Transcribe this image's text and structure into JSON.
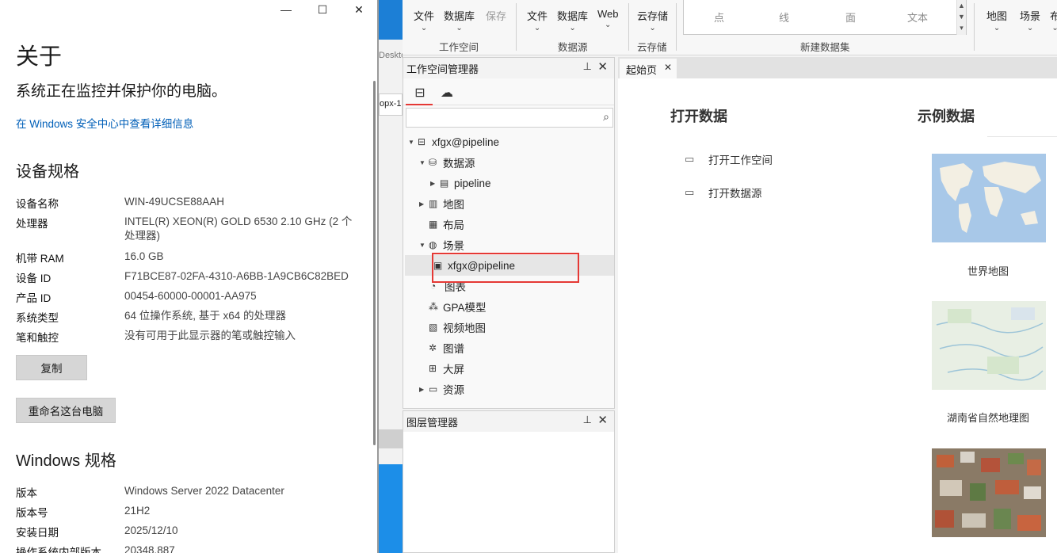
{
  "about": {
    "title": "关于",
    "subtitle": "系统正在监控并保护你的电脑。",
    "link": "在 Windows 安全中心中查看详细信息",
    "device_heading": "设备规格",
    "device_specs": [
      {
        "key": "设备名称",
        "value": "WIN-49UCSE88AAH"
      },
      {
        "key": "处理器",
        "value": "INTEL(R) XEON(R) GOLD 6530   2.10 GHz  (2 个处理器)"
      },
      {
        "key": "机带 RAM",
        "value": "16.0 GB"
      },
      {
        "key": "设备 ID",
        "value": "F71BCE87-02FA-4310-A6BB-1A9CB6C82BED"
      },
      {
        "key": "产品 ID",
        "value": "00454-60000-00001-AA975"
      },
      {
        "key": "系统类型",
        "value": "64 位操作系统, 基于 x64 的处理器"
      },
      {
        "key": "笔和触控",
        "value": "没有可用于此显示器的笔或触控输入"
      }
    ],
    "copy_button": "复制",
    "rename_button": "重命名这台电脑",
    "windows_heading": "Windows 规格",
    "windows_specs": [
      {
        "key": "版本",
        "value": "Windows Server 2022 Datacenter"
      },
      {
        "key": "版本号",
        "value": "21H2"
      },
      {
        "key": "安装日期",
        "value": "2025/12/10"
      },
      {
        "key": "操作系统内部版本",
        "value": "20348.887"
      }
    ],
    "minimize_glyph": "—",
    "maximize_glyph": "☐",
    "close_glyph": "✕"
  },
  "behind": {
    "text1": "Deskto",
    "text2": "opx-1"
  },
  "ribbon": {
    "buttons": {
      "file1": "文件",
      "db1": "数据库",
      "save": "保存",
      "file2": "文件",
      "db2": "数据库",
      "web": "Web",
      "cloud": "云存储",
      "map": "地图",
      "scene": "场景",
      "more": "布"
    },
    "groups": {
      "workspace": "工作空间",
      "datasource": "数据源",
      "cloud": "云存储",
      "newdataset": "新建数据集"
    },
    "gallery": [
      "点",
      "线",
      "面",
      "文本"
    ]
  },
  "workspace_manager": {
    "title": "工作空间管理器",
    "tree": {
      "root": "xfgx@pipeline",
      "datasources": "数据源",
      "pipeline": "pipeline",
      "maps": "地图",
      "layouts": "布局",
      "scenes": "场景",
      "scene_item": "xfgx@pipeline",
      "charts": "图表",
      "gpa": "GPA模型",
      "video_maps": "视频地图",
      "graphs": "图谱",
      "dashboards": "大屏",
      "resources": "资源"
    }
  },
  "layer_manager": {
    "title": "图层管理器"
  },
  "start_page": {
    "tab": "起始页",
    "open_heading": "打开数据",
    "open_workspace": "打开工作空间",
    "open_datasource": "打开数据源",
    "sample_heading": "示例数据",
    "samples": [
      "世界地图",
      "湖南省自然地理图"
    ]
  }
}
